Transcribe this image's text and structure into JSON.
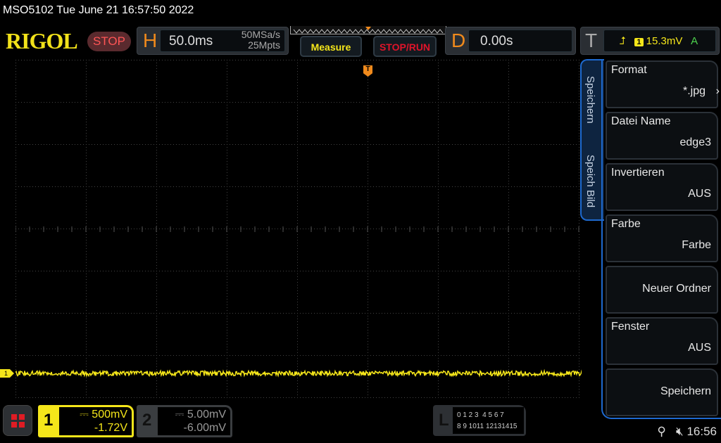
{
  "title": "MSO5102  Tue June 21 16:57:50 2022",
  "logo": "RIGOL",
  "run_state": "STOP",
  "horizontal": {
    "letter": "H",
    "timebase": "50.0ms",
    "sample_rate": "50MSa/s",
    "memory_depth": "25Mpts"
  },
  "buttons": {
    "measure": "Measure",
    "stop_run": "STOP/RUN"
  },
  "delay": {
    "letter": "D",
    "value": "0.00s"
  },
  "trigger": {
    "letter": "T",
    "slope": "rising-edge-icon",
    "source": "1",
    "level": "15.3mV",
    "mode": "A"
  },
  "menu": {
    "tabs": [
      "Speichern",
      "Speich Bild"
    ],
    "items": [
      {
        "label": "Format",
        "value": "*.jpg"
      },
      {
        "label": "Datei Name",
        "value": "edge3"
      },
      {
        "label": "Invertieren",
        "value": "AUS"
      },
      {
        "label": "Farbe",
        "value": "Farbe"
      },
      {
        "label": "",
        "value": "Neuer Ordner"
      },
      {
        "label": "Fenster",
        "value": "AUS"
      },
      {
        "label": "",
        "value": "Speichern"
      }
    ]
  },
  "channels": [
    {
      "num": "1",
      "scale": "500mV",
      "offset": "-1.72V",
      "color": "#f5e61a"
    },
    {
      "num": "2",
      "scale": "5.00mV",
      "offset": "-6.00mV",
      "color": "#8a8d90"
    }
  ],
  "logic": {
    "letter": "L",
    "row1": "0 1 2 3  4 5 6 7",
    "row2": "8 9 1011 12131415"
  },
  "status": {
    "usb": "usb-icon",
    "sound": "mute-icon",
    "time": "16:56"
  },
  "ch1_marker": "1",
  "trigger_marker": "T"
}
